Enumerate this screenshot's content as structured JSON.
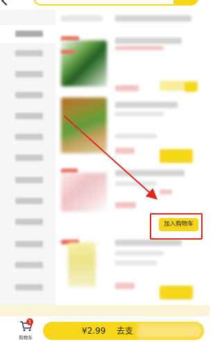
{
  "product_action": {
    "add_to_cart_label": "加入购物车"
  },
  "cart": {
    "label": "购物车",
    "badge_count": "1"
  },
  "checkout": {
    "price": "¥2.99",
    "label": "去支"
  },
  "colors": {
    "accent": "#f7d51a",
    "highlight": "#e0281e"
  }
}
